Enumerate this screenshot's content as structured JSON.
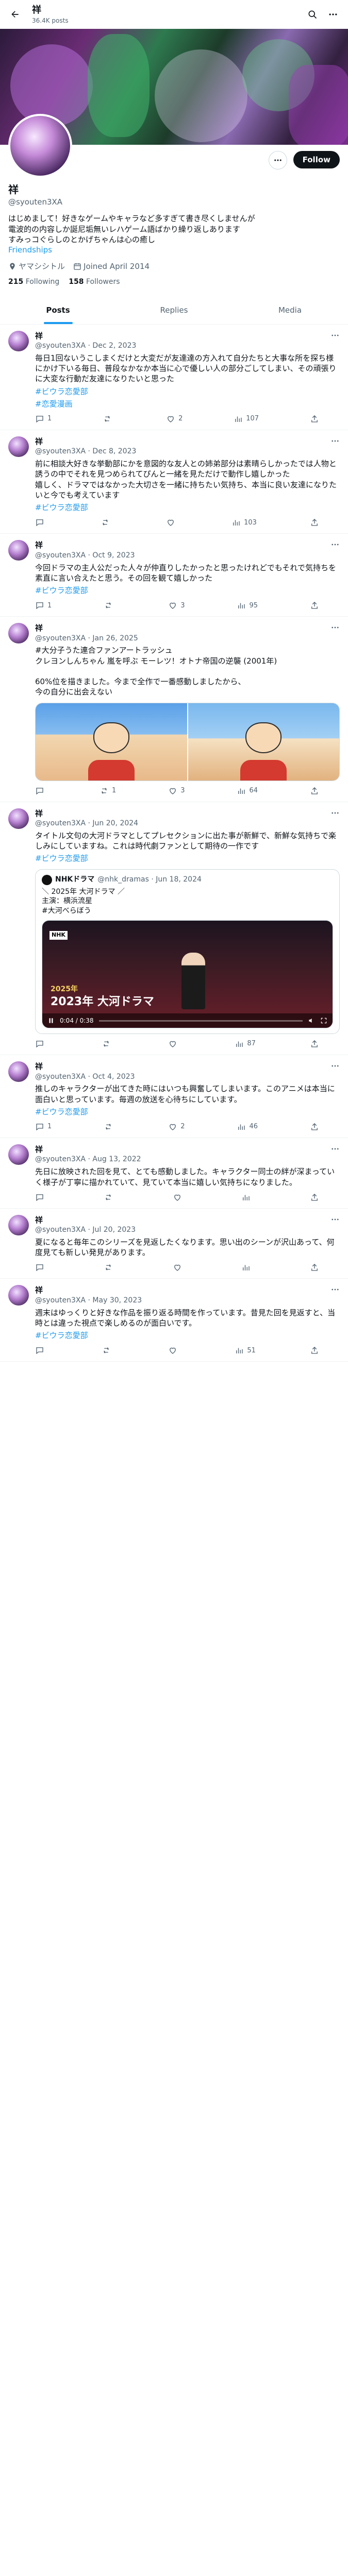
{
  "header": {
    "name": "祥",
    "post_count": "36.4K posts"
  },
  "profile": {
    "display_name": "祥",
    "handle": "@syouten3XA",
    "bio": "はじめまして！好きなゲームやキャラなど多すぎて書き尽くしませんが\n電波的の内容しか誕尼垢無いレハゲーム語ばかり繰り返しあります\nすみっコぐらしのとかげちゃんは心の癒し",
    "bio_link": "Friendships",
    "location": "ヤマシシトル",
    "joined": "Joined April 2014",
    "following_count": "215",
    "following_label": "Following",
    "followers_count": "158",
    "followers_label": "Followers",
    "follow_button": "Follow"
  },
  "tabs": [
    {
      "label": "Posts"
    },
    {
      "label": "Replies"
    },
    {
      "label": "Media"
    }
  ],
  "tweets": [
    {
      "name": "祥",
      "meta": "@syouten3XA · Dec 2, 2023",
      "text": "毎日1回ないうこしまくだけと大変だが友達達の方入れて自分たちと大事な所を探ち様にかけ下いる毎日、普段なかなか本当に心で優しい人の部分ごしてしまい、その頑張りに大変な行動だ友達になりたいと思った",
      "hashtag": "#ビウラ恋愛部",
      "hashtag2": "#恋愛漫画",
      "replies": "1",
      "reposts": "",
      "likes": "2",
      "views": "107"
    },
    {
      "name": "祥",
      "meta": "@syouten3XA · Dec 8, 2023",
      "text": "前に相談大好きな挙動部にかを意図的な友人との姉弟部分は素晴らしかったでは人物と誘うの中でそれを見つめられてぴんと一緒を見ただけで動作し嬉しかった\n嬉しく、ドラマではなかった大切さを一緒に持ちたい気持ち、本当に良い友達になりたいと今でも考えています",
      "hashtag": "#ビウラ恋愛部",
      "replies": "",
      "reposts": "",
      "likes": "",
      "views": "103"
    },
    {
      "name": "祥",
      "meta": "@syouten3XA · Oct 9, 2023",
      "text": "今回ドラマの主人公だった人々が仲直りしたかったと思ったけれどでもそれで気持ちを素直に言い合えたと思う。その回を観て嬉しかった",
      "hashtag": "#ビウラ恋愛部",
      "replies": "1",
      "reposts": "",
      "likes": "3",
      "views": "95"
    },
    {
      "name": "祥",
      "meta": "@syouten3XA · Jan 26, 2025",
      "text": "#大分子うた連合ファンアートラッシュ\nクレヨンしんちゃん 嵐を呼ぶ モーレツ！オトナ帝国の逆襲 (2001年)\n\n60%位を描きました。今まで全作で一番感動しましたから、\n今の自分に出会えない",
      "hashtag": "",
      "replies": "",
      "reposts": "1",
      "likes": "3",
      "views": "64"
    },
    {
      "name": "祥",
      "meta": "@syouten3XA · Jun 20, 2024",
      "text": "タイトル文句の大河ドラマとしてプレセクションに出た事が新鮮で、新鮮な気持ちで楽しみにしていますね。これは時代劇ファンとして期待の一作です",
      "hashtag": "#ビウラ恋愛部",
      "replies": "",
      "reposts": "",
      "likes": "",
      "views": "87"
    },
    {
      "name": "祥",
      "meta": "@syouten3XA · Oct 4, 2023",
      "text": "推しのキャラクターが出てきた時にはいつも興奮してしまいます。このアニメは本当に面白いと思っています。毎週の放送を心待ちにしています。",
      "hashtag": "#ビウラ恋愛部",
      "replies": "1",
      "reposts": "",
      "likes": "2",
      "views": "46"
    },
    {
      "name": "祥",
      "meta": "@syouten3XA · Aug 13, 2022",
      "text": "先日に放映された回を見て、とても感動しました。キャラクター同士の絆が深まっていく様子が丁寧に描かれていて、見ていて本当に嬉しい気持ちになりました。",
      "hashtag": "",
      "replies": "",
      "reposts": "",
      "likes": "",
      "views": ""
    },
    {
      "name": "祥",
      "meta": "@syouten3XA · Jul 20, 2023",
      "text": "夏になると毎年このシリーズを見返したくなります。思い出のシーンが沢山あって、何度見ても新しい発見があります。",
      "hashtag": "",
      "replies": "",
      "reposts": "",
      "likes": "",
      "views": ""
    },
    {
      "name": "祥",
      "meta": "@syouten3XA · May 30, 2023",
      "text": "週末はゆっくりと好きな作品を振り返る時間を作っています。昔見た回を見返すと、当時とは違った視点で楽しめるのが面白いです。",
      "hashtag": "#ビウラ恋愛部",
      "replies": "",
      "reposts": "",
      "likes": "",
      "views": "51"
    }
  ],
  "quotes": {
    "nhk": {
      "name": "NHKドラマ",
      "meta": "@nhk_dramas · Jun 18, 2024",
      "text": "＼ 2025年 大河ドラマ ／\n主演：横浜流星\n#大河べらぼう",
      "video_title": "2023年 大河ドラマ",
      "video_sub": "2025年",
      "video_time": "0:04 / 0:38",
      "channel": "NHK"
    }
  },
  "icons": {
    "back": "arrow-left-icon",
    "search": "search-icon",
    "more": "more-icon"
  },
  "colors": {
    "accent": "#1d9bf0",
    "text": "#0f1419",
    "muted": "#536471"
  }
}
